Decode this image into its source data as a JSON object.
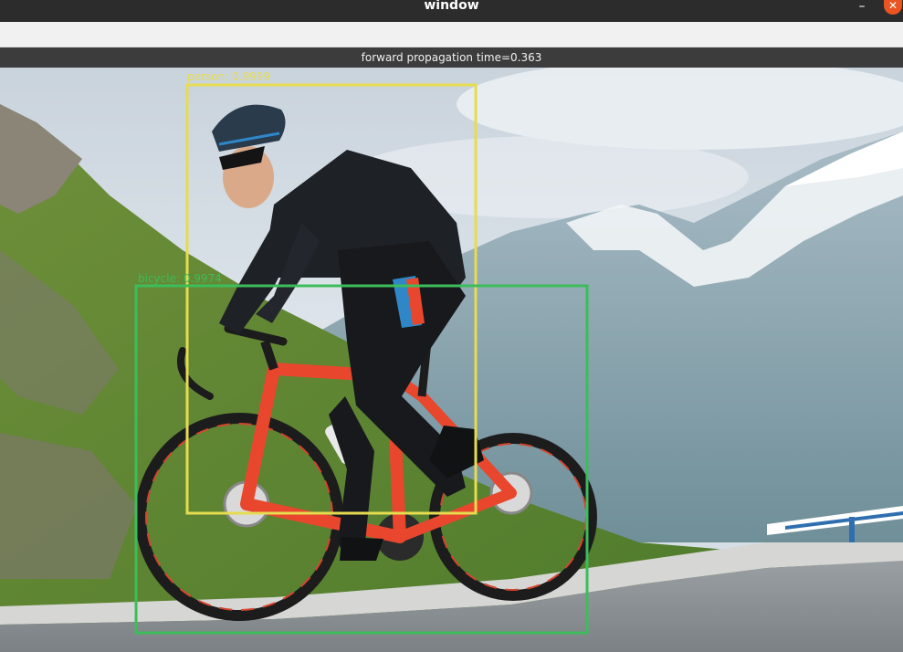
{
  "window": {
    "title": "window",
    "minimize_glyph": "–",
    "close_glyph": "✕"
  },
  "status": {
    "text": "forward propagation time=0.363"
  },
  "detections": [
    {
      "label": "person: 0.9999",
      "color": "#e6dc50"
    },
    {
      "label": "bicycle: 0.9974",
      "color": "#3cbd5a"
    }
  ],
  "icons": {
    "minimize": "minimize-icon",
    "close": "close-icon"
  }
}
